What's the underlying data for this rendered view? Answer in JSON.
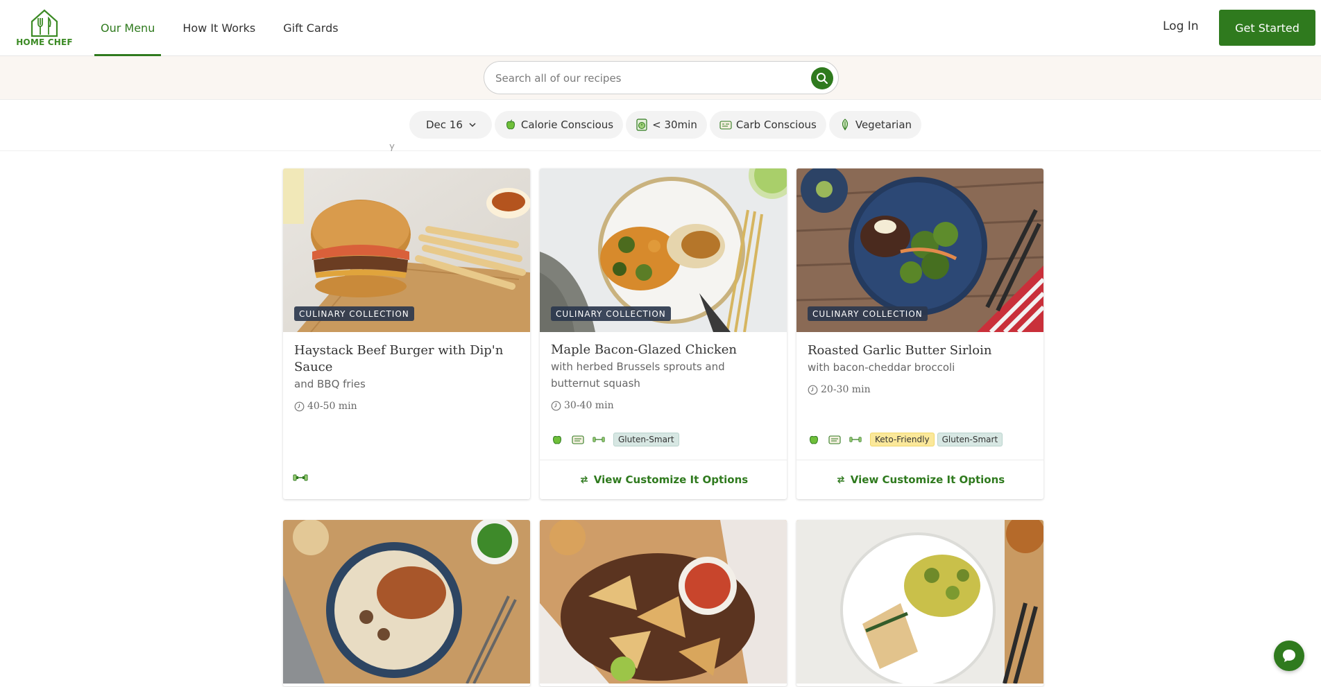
{
  "header": {
    "logo_text": "HOME CHEF",
    "nav": [
      {
        "label": "Our Menu",
        "active": true
      },
      {
        "label": "How It Works",
        "active": false
      },
      {
        "label": "Gift Cards",
        "active": false
      }
    ],
    "login_label": "Log In",
    "cta_label": "Get Started"
  },
  "search": {
    "placeholder": "Search all of our recipes"
  },
  "filters": {
    "date": "Dec 16",
    "chips": [
      {
        "label": "Calorie Conscious",
        "icon": "apple-icon"
      },
      {
        "label": "< 30min",
        "icon": "timer-icon"
      },
      {
        "label": "Carb Conscious",
        "icon": "bread-icon"
      },
      {
        "label": "Vegetarian",
        "icon": "leaf-icon"
      }
    ]
  },
  "cards": [
    {
      "badge": "CULINARY COLLECTION",
      "title": "Haystack Beef Burger with Dip'n Sauce",
      "subtitle": "and BBQ fries",
      "time": "40-50 min",
      "image": "burger-with-fries"
    },
    {
      "badge": "CULINARY COLLECTION",
      "title": "Maple Bacon-Glazed Chicken",
      "subtitle": "with herbed Brussels sprouts and butternut squash",
      "time": "30-40 min",
      "tags": [
        "Gluten-Smart"
      ],
      "action": "View Customize It Options",
      "image": "chicken-with-vegetables"
    },
    {
      "badge": "CULINARY COLLECTION",
      "title": "Roasted Garlic Butter Sirloin",
      "subtitle": "with bacon-cheddar broccoli",
      "time": "20-30 min",
      "tags": [
        "Keto-Friendly",
        "Gluten-Smart"
      ],
      "action": "View Customize It Options",
      "image": "steak-with-broccoli"
    },
    {
      "image": "chicken-over-rice"
    },
    {
      "image": "quesadilla-board"
    },
    {
      "image": "spinach-pie-zucchini"
    }
  ],
  "colors": {
    "brand_green": "#2f7a1e",
    "badge_bg": "#2d384e",
    "gluten_tag": "#d7e7e3",
    "keto_tag": "#fbe89a"
  }
}
